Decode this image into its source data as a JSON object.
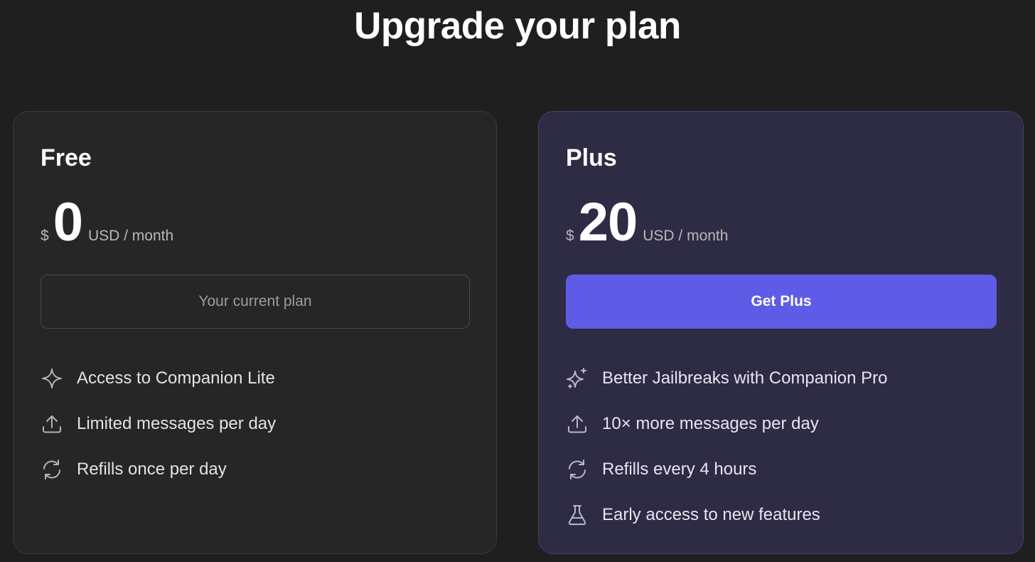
{
  "page": {
    "title": "Upgrade your plan"
  },
  "plans": [
    {
      "name": "Free",
      "currency": "$",
      "amount": "0",
      "period": "USD / month",
      "button_label": "Your current plan",
      "features": [
        {
          "icon": "sparkle-icon",
          "text": "Access to Companion Lite"
        },
        {
          "icon": "upload-icon",
          "text": "Limited messages per day"
        },
        {
          "icon": "refresh-icon",
          "text": "Refills once per day"
        }
      ]
    },
    {
      "name": "Plus",
      "currency": "$",
      "amount": "20",
      "period": "USD / month",
      "button_label": "Get Plus",
      "features": [
        {
          "icon": "sparkles-icon",
          "text": "Better Jailbreaks with Companion Pro"
        },
        {
          "icon": "upload-icon",
          "text": "10× more messages per day"
        },
        {
          "icon": "refresh-icon",
          "text": "Refills every 4 hours"
        },
        {
          "icon": "flask-icon",
          "text": "Early access to new features"
        }
      ]
    }
  ],
  "colors": {
    "background": "#1f1f1f",
    "free_card": "#262626",
    "plus_card": "#2e2b45",
    "accent": "#5e5ce6"
  }
}
